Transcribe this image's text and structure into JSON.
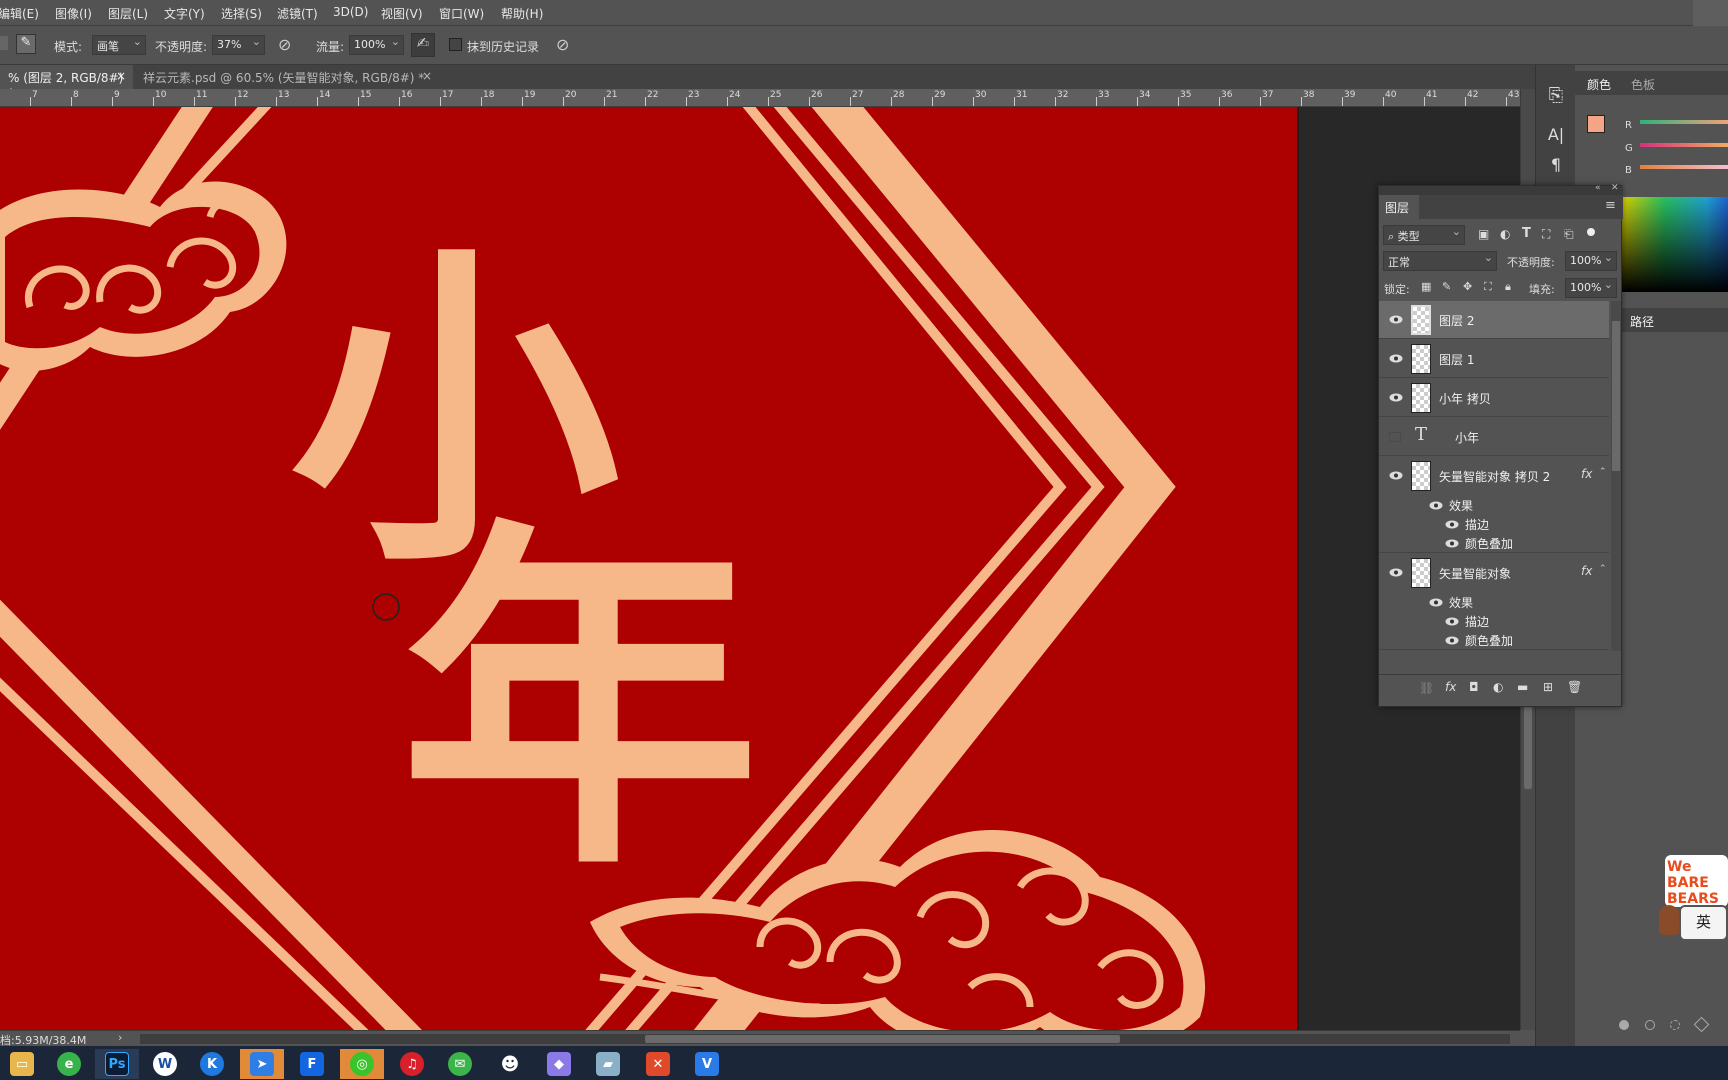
{
  "menu": [
    "编辑(E)",
    "图像(I)",
    "图层(L)",
    "文字(Y)",
    "选择(S)",
    "滤镜(T)",
    "3D(D)",
    "视图(V)",
    "窗口(W)",
    "帮助(H)"
  ],
  "options": {
    "mode_label": "模式:",
    "mode_value": "画笔",
    "opacity_label": "不透明度:",
    "opacity_value": "37%",
    "flow_label": "流量:",
    "flow_value": "100%",
    "erase_history_label": "抹到历史记录"
  },
  "tabs": [
    {
      "label": "% (图层 2, RGB/8#) *",
      "close": "×"
    },
    {
      "label": "祥云元素.psd @ 60.5% (矢量智能对象, RGB/8#) *",
      "close": "×"
    }
  ],
  "ruler_ticks": [
    "7",
    "8",
    "9",
    "10",
    "11",
    "12",
    "13",
    "14",
    "15",
    "16",
    "17",
    "18",
    "19",
    "20",
    "21",
    "22",
    "23",
    "24",
    "25",
    "26",
    "27",
    "28",
    "29",
    "30",
    "31",
    "32",
    "33",
    "34",
    "35",
    "36",
    "37",
    "38",
    "39",
    "40",
    "41",
    "42",
    "43"
  ],
  "canvas": {
    "text_top": "小",
    "text_bottom": "年",
    "bg_color": "#ad0000",
    "art_color": "#f7b889"
  },
  "status": {
    "doc_info": "档:5.93M/38.4M"
  },
  "right_dock": {
    "tab_color": "颜色",
    "tab_swatches": "色板",
    "r": "R",
    "g": "G",
    "b": "B",
    "paths": "路径"
  },
  "layers_panel": {
    "title": "图层",
    "filter_kind": "类型",
    "blend_mode": "正常",
    "opacity_label": "不透明度:",
    "opacity_value": "100%",
    "lock_label": "锁定:",
    "fill_label": "填充:",
    "fill_value": "100%",
    "layers": [
      {
        "name": "图层 2",
        "selected": true
      },
      {
        "name": "图层 1"
      },
      {
        "name": "小年 拷贝"
      },
      {
        "name": "小年",
        "kind": "text"
      },
      {
        "name": "矢量智能对象 拷贝 2",
        "fx": "fx",
        "effects_label": "效果",
        "effects": [
          "描边",
          "颜色叠加"
        ]
      },
      {
        "name": "矢量智能对象",
        "fx": "fx",
        "effects_label": "效果",
        "effects": [
          "描边",
          "颜色叠加"
        ]
      }
    ]
  },
  "overlay_badge": {
    "top": "We BARE BEARS",
    "ime": "英"
  },
  "colors": {
    "fg_swatch": "#f4a583",
    "ui_bg": "#535353",
    "panel_dark": "#424242"
  }
}
